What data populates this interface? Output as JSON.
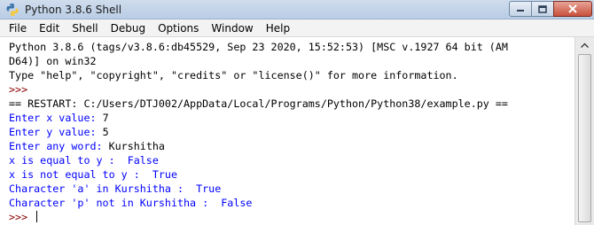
{
  "window": {
    "title": "Python 3.8.6 Shell",
    "icon": "python-icon",
    "controls": [
      "minimize-icon",
      "maximize-icon",
      "close-icon"
    ]
  },
  "menu": {
    "items": [
      "File",
      "Edit",
      "Shell",
      "Debug",
      "Options",
      "Window",
      "Help"
    ]
  },
  "shell": {
    "banner_1": "Python 3.8.6 (tags/v3.8.6:db45529, Sep 23 2020, 15:52:53) [MSC v.1927 64 bit (AM",
    "banner_2": "D64)] on win32",
    "banner_3": "Type \"help\", \"copyright\", \"credits\" or \"license()\" for more information.",
    "prompt_1": ">>> ",
    "restart": "== RESTART: C:/Users/DTJ002/AppData/Local/Programs/Python/Python38/example.py ==",
    "x_prompt": "Enter x value: ",
    "x_value": "7",
    "y_prompt": "Enter y value: ",
    "y_value": "5",
    "word_prompt": "Enter any word: ",
    "word_value": "Kurshitha",
    "out_1": "x is equal to y :  False",
    "out_2": "x is not equal to y :  True",
    "out_3": "Character 'a' in Kurshitha :  True",
    "out_4": "Character 'p' not in Kurshitha :  False",
    "prompt_2": ">>> "
  },
  "colors": {
    "prompt": "#8b0000",
    "stdout": "#0000ff",
    "text": "#000000"
  }
}
